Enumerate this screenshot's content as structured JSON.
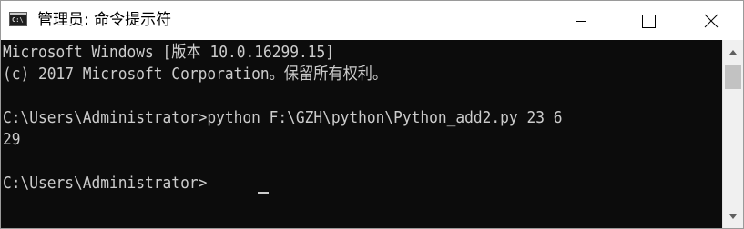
{
  "window": {
    "title": "管理员: 命令提示符",
    "icon": "command-prompt-icon",
    "icon_glyph": "C:\\"
  },
  "controls": {
    "minimize_icon": "minimize-icon",
    "maximize_icon": "maximize-icon",
    "close_icon": "close-icon"
  },
  "console": {
    "lines": [
      "Microsoft Windows [版本 10.0.16299.15]",
      "(c) 2017 Microsoft Corporation。保留所有权利。",
      "",
      "C:\\Users\\Administrator>python F:\\GZH\\python\\Python_add2.py 23 6",
      "29",
      "",
      "C:\\Users\\Administrator>"
    ],
    "background": "#0c0c0c",
    "foreground": "#cccccc"
  },
  "scrollbar": {
    "up_icon": "scroll-up-arrow-icon",
    "down_icon": "scroll-down-arrow-icon"
  }
}
